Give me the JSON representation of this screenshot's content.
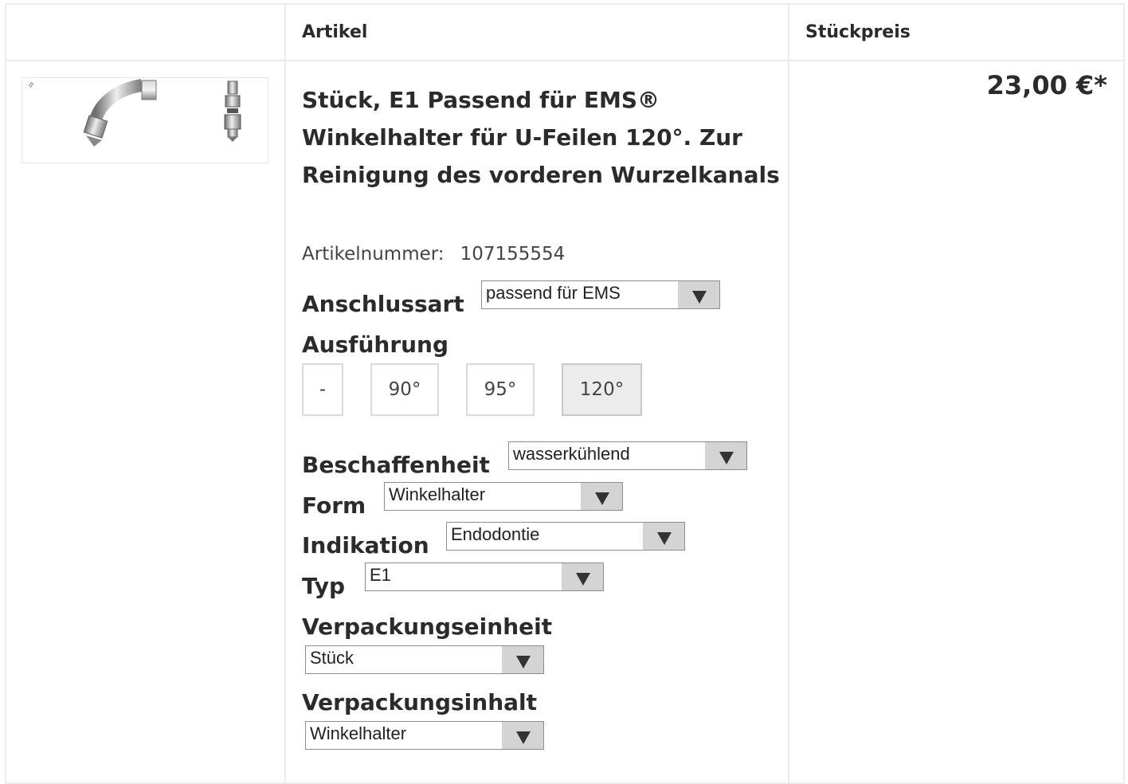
{
  "table": {
    "col_article": "Artikel",
    "col_unit_price": "Stückpreis"
  },
  "product": {
    "title": "Stück, E1 Passend für EMS® Winkelhalter für U-Feilen 120°. Zur Reinigung des vorderen Wurzelkanals",
    "sku_label": "Artikelnummer:",
    "sku_value": "107155554",
    "price": "23,00 €*"
  },
  "variants": {
    "connection": {
      "label": "Anschlussart",
      "value": "passend für EMS"
    },
    "execution": {
      "label": "Ausführung",
      "options": [
        "-",
        "90°",
        "95°",
        "120°"
      ],
      "selected": "120°"
    },
    "texture": {
      "label": "Beschaffenheit",
      "value": "wasserkühlend"
    },
    "form": {
      "label": "Form",
      "value": "Winkelhalter"
    },
    "indication": {
      "label": "Indikation",
      "value": "Endodontie"
    },
    "type": {
      "label": "Typ",
      "value": "E1"
    },
    "pack_unit": {
      "label": "Verpackungseinheit",
      "value": "Stück"
    },
    "pack_content": {
      "label": "Verpackungsinhalt",
      "value": "Winkelhalter"
    }
  },
  "colors": {
    "text": "#2b2b2b",
    "border": "#ececec",
    "selected_option_bg": "#ececec",
    "select_arrow_bg": "#d4d4d4"
  },
  "icons": {
    "select_arrow": "triangle-down-icon"
  }
}
